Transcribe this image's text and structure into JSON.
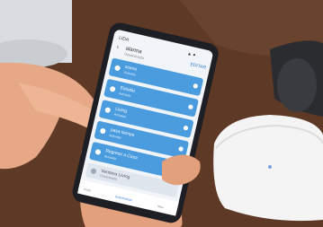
{
  "status_bar": {
    "carrier": "LIDA"
  },
  "app_header": {
    "title": "alarma",
    "subtitle": "Desactivada",
    "action_label": "EDITAR"
  },
  "scenes": [
    {
      "label": "scene",
      "status": "Activado",
      "on": true
    },
    {
      "label": "Estudio",
      "status": "Activado",
      "on": true
    },
    {
      "label": "Living",
      "status": "Activado",
      "on": true
    },
    {
      "label": "pasa tiempo",
      "status": "Activado",
      "on": true
    },
    {
      "label": "Regreso a Casa",
      "status": "Activado",
      "on": true
    },
    {
      "label": "Ventana Living",
      "status": "Desactivado",
      "on": false
    }
  ],
  "bottom_nav": {
    "items": [
      "Inicio",
      "Automatizac.",
      "Mas"
    ],
    "active_index": 1
  },
  "hub_device": {
    "name": "smart-home-hub"
  },
  "colors": {
    "table": "#5e3a26",
    "background": "#efeae2",
    "phone_body": "#1d1f24",
    "screen_bg": "#f1f4f8",
    "scene_tile": "#4a9cde",
    "scene_tile_off": "#dfe6ee",
    "accent": "#2f7fd3",
    "hub": "#f4f4f4",
    "skin": "#e6a887"
  }
}
